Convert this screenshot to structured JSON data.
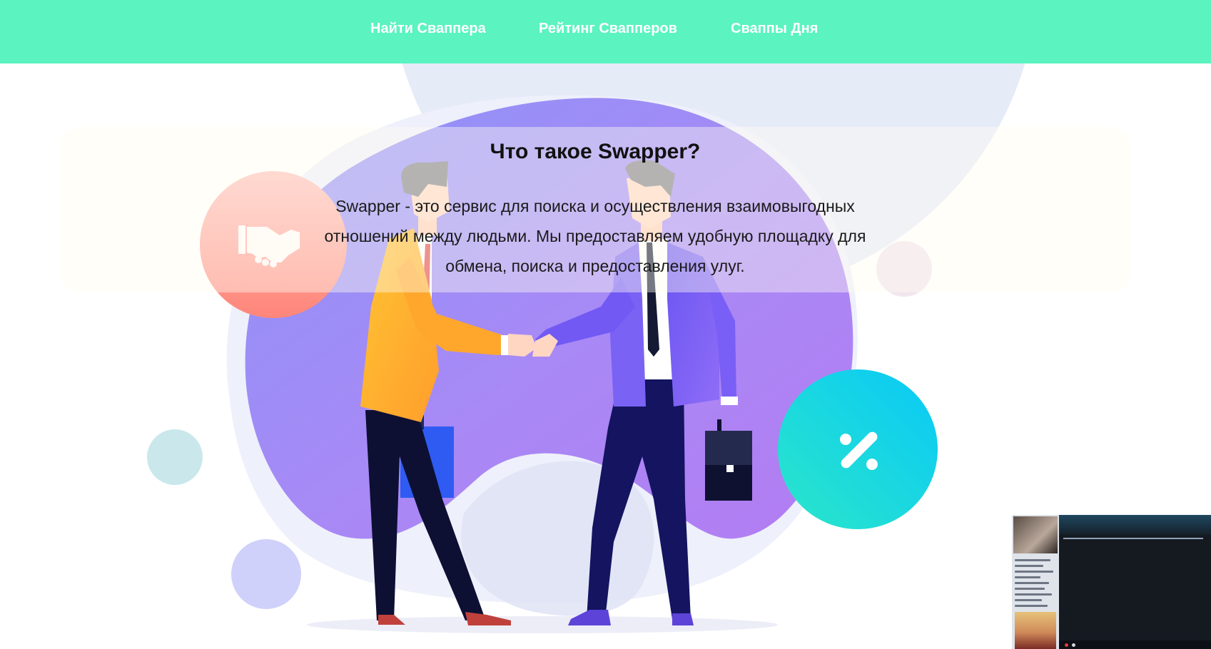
{
  "nav": {
    "items": [
      {
        "label": "Найти Свапперa"
      },
      {
        "label": "Рейтинг Свапперов"
      },
      {
        "label": "Сваппы Дня"
      }
    ]
  },
  "about": {
    "title": "Что такое Swapper?",
    "description": "Swapper - это сервис для поиска и осуществления взаимовыгодных отношений между людьми. Мы предоставляем удобную площадку для обмена, поиска и предоставления улуг."
  },
  "illustration": {
    "icons": [
      "handshake-icon",
      "percent-icon"
    ]
  },
  "colors": {
    "nav_bg": "#5bf3c0",
    "nav_text": "#ffffff",
    "blob_purple": "#9b7cf6",
    "handshake_circle": "#ff8f87",
    "percent_circle": "#13d6f0"
  }
}
